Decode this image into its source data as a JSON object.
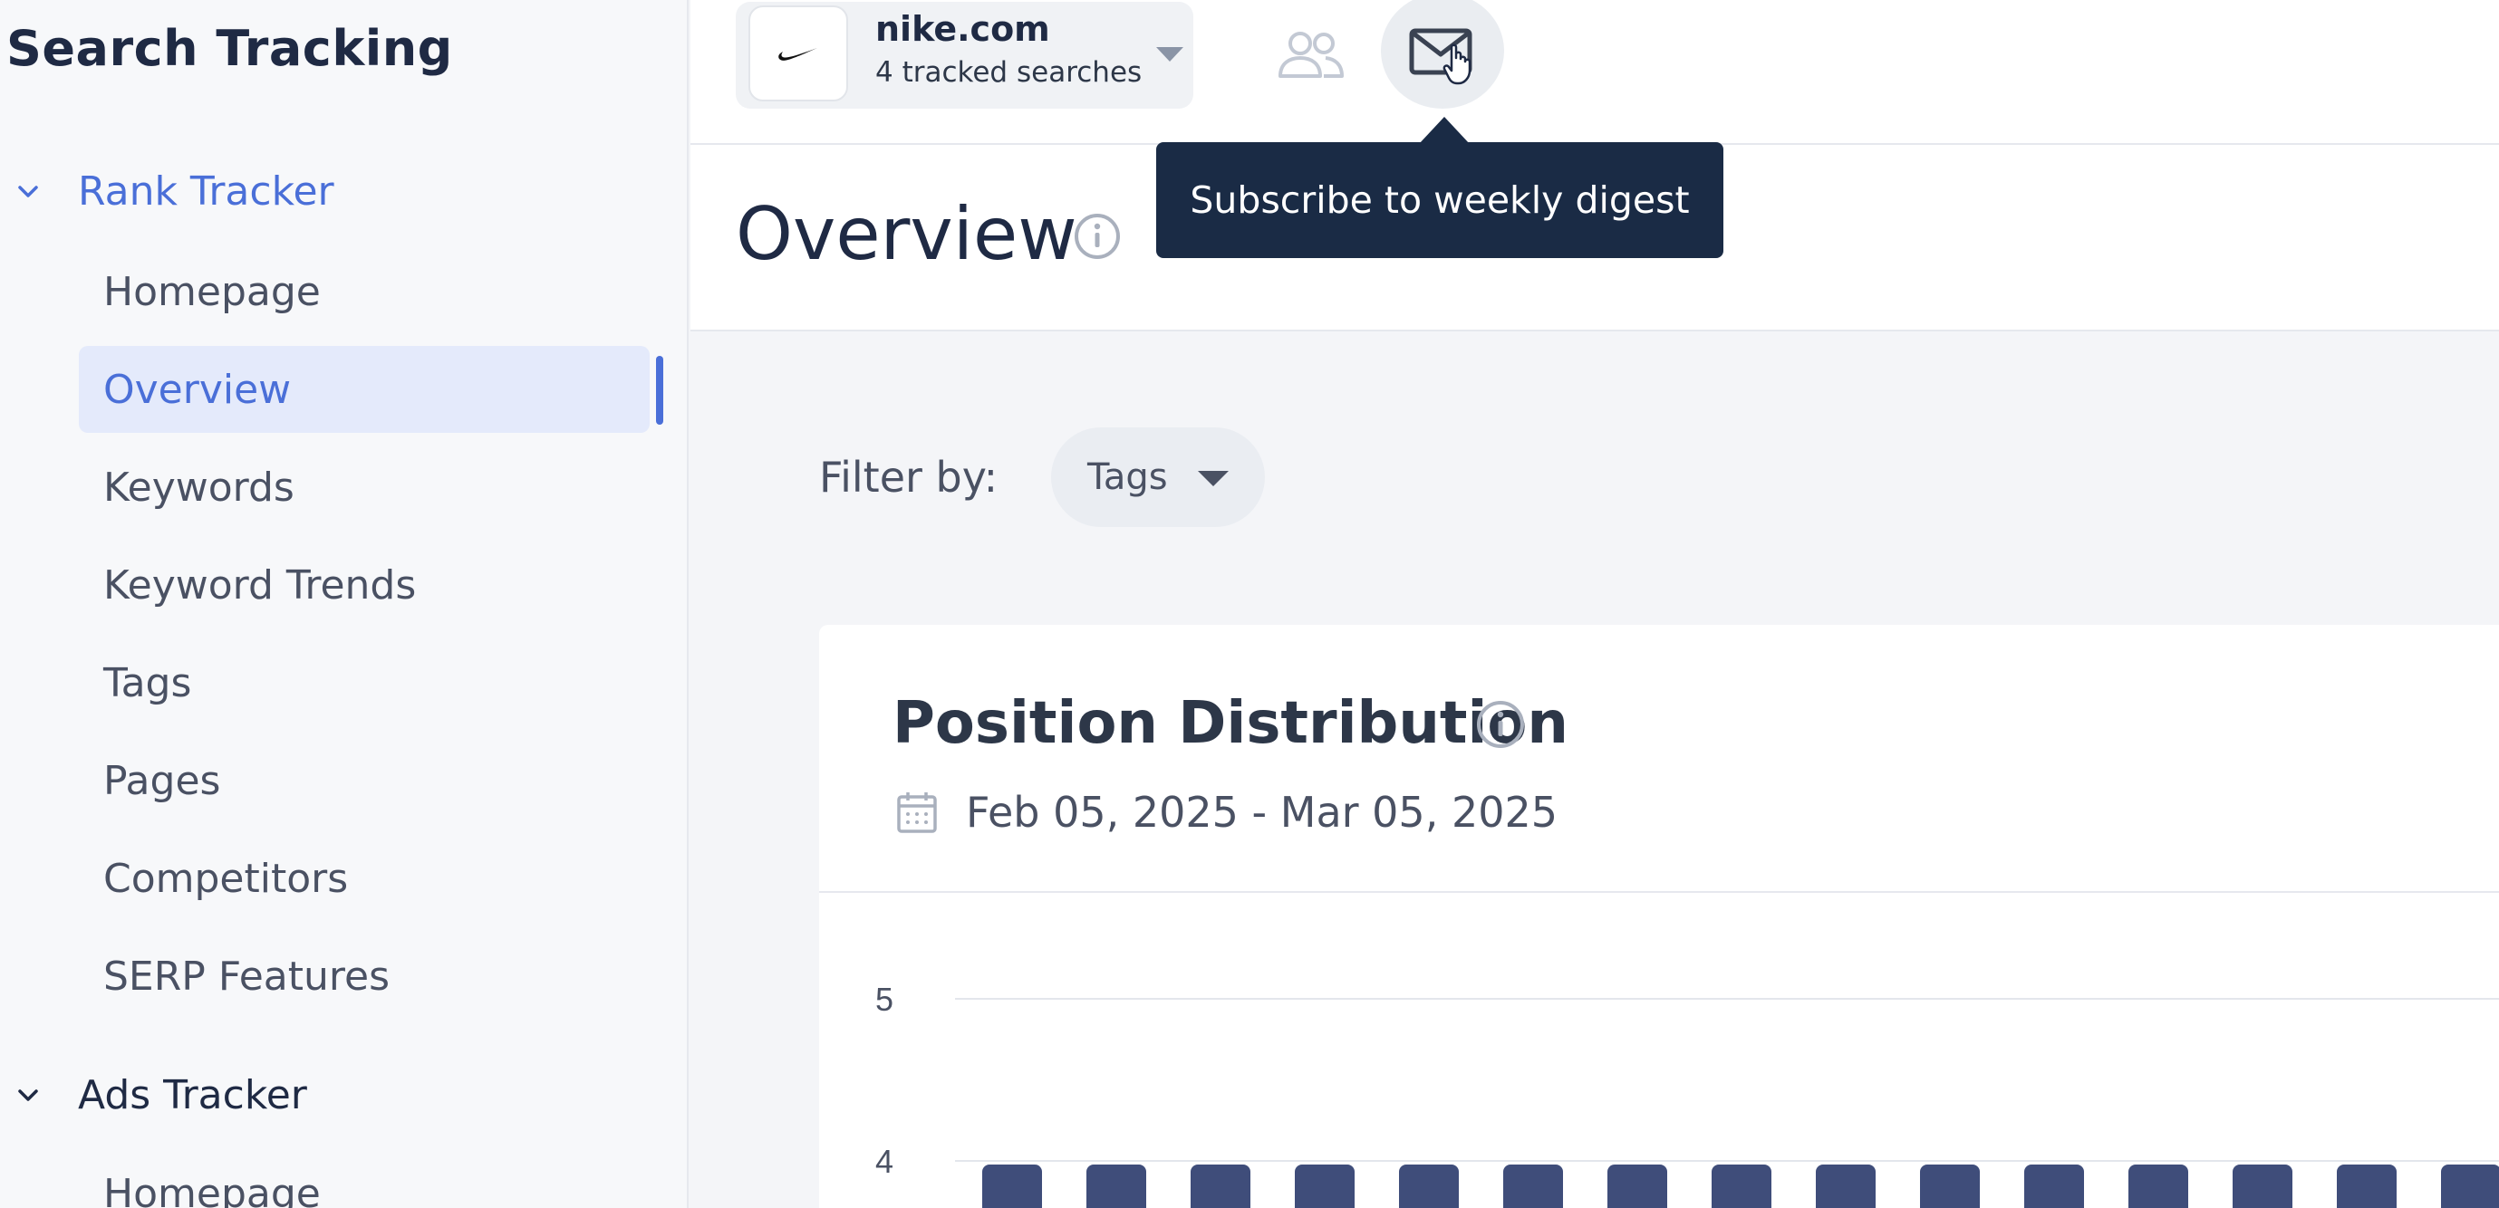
{
  "sidebar": {
    "app_title": "Search Tracking",
    "rank_section": {
      "label": "Rank Tracker",
      "items": [
        {
          "label": "Homepage"
        },
        {
          "label": "Overview",
          "active": true
        },
        {
          "label": "Keywords"
        },
        {
          "label": "Keyword Trends"
        },
        {
          "label": "Tags"
        },
        {
          "label": "Pages"
        },
        {
          "label": "Competitors"
        },
        {
          "label": "SERP Features"
        }
      ]
    },
    "ads_section": {
      "label": "Ads Tracker",
      "items": [
        {
          "label": "Homepage"
        }
      ]
    }
  },
  "header": {
    "site_name": "nike.com",
    "site_subtitle": "4 tracked searches",
    "tooltip": "Subscribe to weekly digest"
  },
  "main": {
    "title": "Overview",
    "filter_label": "Filter by:",
    "tags_button": "Tags"
  },
  "card": {
    "title": "Position Distribution",
    "date_range": "Feb 05, 2025 - Mar 05, 2025"
  },
  "colors": {
    "accent": "#4a6fd8",
    "bar": "#3f4d7a",
    "tooltip_bg": "#1a2b45"
  },
  "chart_data": {
    "type": "bar",
    "y_ticks": [
      5,
      4
    ],
    "bar_count": 15,
    "bar_color": "#3f4d7a"
  }
}
